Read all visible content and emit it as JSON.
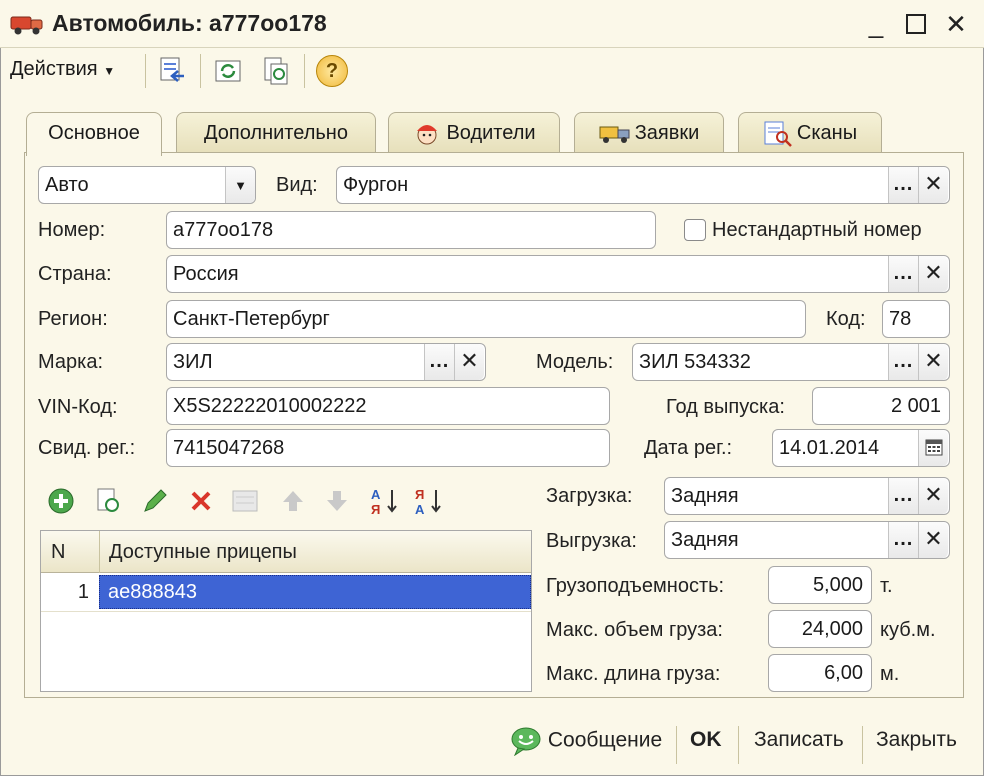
{
  "window": {
    "title": "Автомобиль: а777оо178"
  },
  "toolbar": {
    "actions_label": "Действия",
    "help_glyph": "?"
  },
  "tabs": [
    {
      "label": "Основное"
    },
    {
      "label": "Дополнительно"
    },
    {
      "label": "Водители"
    },
    {
      "label": "Заявки"
    },
    {
      "label": "Сканы"
    }
  ],
  "form": {
    "type_value": "Авто",
    "kind_label": "Вид:",
    "kind_value": "Фургон",
    "number_label": "Номер:",
    "number_value": "а777оо178",
    "nonstandard_label": "Нестандартный номер",
    "country_label": "Страна:",
    "country_value": "Россия",
    "region_label": "Регион:",
    "region_value": "Санкт-Петербург",
    "code_label": "Код:",
    "code_value": "78",
    "brand_label": "Марка:",
    "brand_value": "ЗИЛ",
    "model_label": "Модель:",
    "model_value": "ЗИЛ 534332",
    "vin_label": "VIN-Код:",
    "vin_value": "X5S22222010002222",
    "year_label": "Год выпуска:",
    "year_value": "2 001",
    "reg_cert_label": "Свид. рег.:",
    "reg_cert_value": "7415047268",
    "reg_date_label": "Дата рег.:",
    "reg_date_value": "14.01.2014",
    "loading_label": "Загрузка:",
    "loading_value": "Задняя",
    "unloading_label": "Выгрузка:",
    "unloading_value": "Задняя",
    "capacity_label": "Грузоподъемность:",
    "capacity_value": "5,000",
    "capacity_unit": "т.",
    "volume_label": "Макс. объем груза:",
    "volume_value": "24,000",
    "volume_unit": "куб.м.",
    "length_label": "Макс. длина груза:",
    "length_value": "6,00",
    "length_unit": "м."
  },
  "buttons": {
    "dots": "...",
    "clear": "✕"
  },
  "trailers": {
    "col_n": "N",
    "col_name": "Доступные прицепы",
    "rows": [
      {
        "n": "1",
        "name": "ае888843"
      }
    ]
  },
  "statusbar": {
    "message": "Сообщение",
    "ok": "OK",
    "save": "Записать",
    "close": "Закрыть"
  },
  "colors": {
    "selection": "#3e64d4",
    "window_bg": "#fbf8e9"
  }
}
